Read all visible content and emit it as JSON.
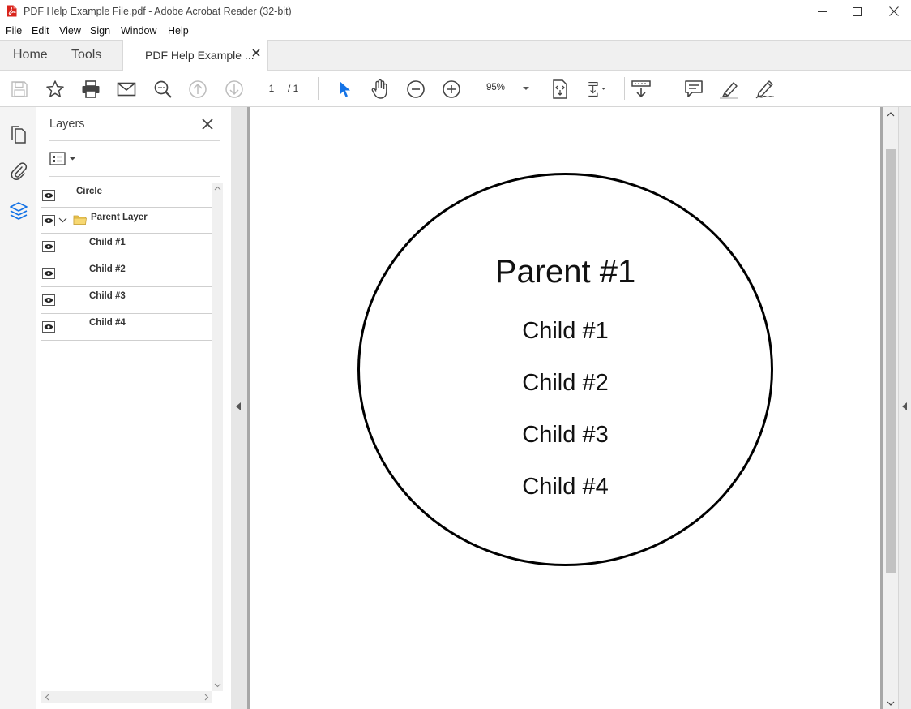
{
  "window": {
    "title": "PDF Help Example File.pdf - Adobe Acrobat Reader (32-bit)"
  },
  "menu": [
    "File",
    "Edit",
    "View",
    "Sign",
    "Window",
    "Help"
  ],
  "tabs": {
    "home": "Home",
    "tools": "Tools",
    "document": "PDF Help Example ..."
  },
  "toolbar": {
    "page_current": "1",
    "page_total": "/ 1",
    "zoom": "95%"
  },
  "layers_panel": {
    "title": "Layers",
    "rows": [
      {
        "label": "Circle"
      },
      {
        "label": "Parent Layer"
      },
      {
        "label": "Child #1"
      },
      {
        "label": "Child #2"
      },
      {
        "label": "Child #3"
      },
      {
        "label": "Child #4"
      }
    ]
  },
  "document": {
    "heading": "Parent #1",
    "lines": [
      "Child #1",
      "Child #2",
      "Child #3",
      "Child #4"
    ]
  },
  "colors": {
    "accent_blue": "#1473e6",
    "pdf_red": "#d9231b",
    "folder_yellow": "#f2c94c"
  }
}
